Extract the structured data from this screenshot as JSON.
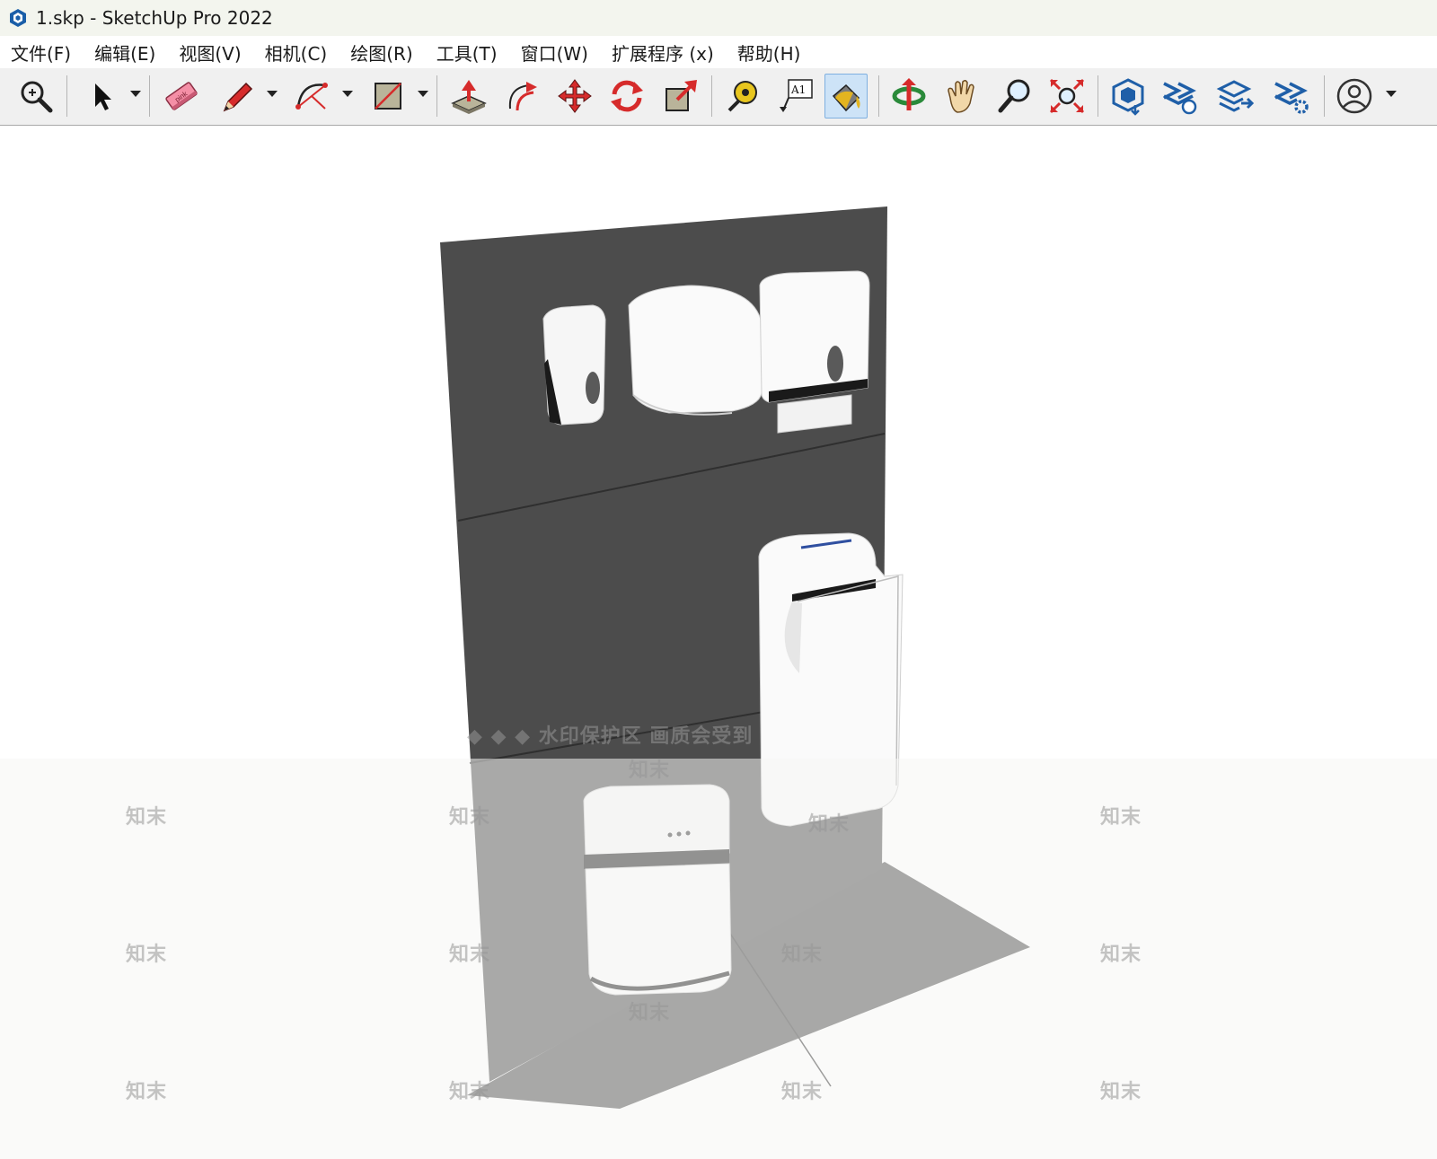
{
  "window": {
    "title": "1.skp - SketchUp Pro 2022"
  },
  "menu": [
    "文件(F)",
    "编辑(E)",
    "视图(V)",
    "相机(C)",
    "绘图(R)",
    "工具(T)",
    "窗口(W)",
    "扩展程序 (x)",
    "帮助(H)"
  ],
  "toolbar": {
    "tools": [
      {
        "name": "zoom-window-icon"
      },
      {
        "name": "select-arrow-icon"
      },
      {
        "name": "eraser-icon"
      },
      {
        "name": "pencil-line-icon"
      },
      {
        "name": "arc-icon"
      },
      {
        "name": "rectangle-icon"
      },
      {
        "name": "push-pull-icon"
      },
      {
        "name": "offset-icon"
      },
      {
        "name": "move-icon"
      },
      {
        "name": "rotate-icon"
      },
      {
        "name": "scale-icon"
      },
      {
        "name": "tape-measure-icon"
      },
      {
        "name": "text-label-icon"
      },
      {
        "name": "paint-bucket-icon"
      },
      {
        "name": "orbit-icon"
      },
      {
        "name": "pan-hand-icon"
      },
      {
        "name": "zoom-icon"
      },
      {
        "name": "zoom-extents-icon"
      },
      {
        "name": "3d-warehouse-icon"
      },
      {
        "name": "extension-warehouse-icon"
      },
      {
        "name": "layout-send-icon"
      },
      {
        "name": "extension-manager-icon"
      },
      {
        "name": "account-icon"
      }
    ],
    "text_label_glyph": "A1",
    "eraser_brand": "pink"
  },
  "viewport": {
    "watermark_banner": "◆ ◆ ◆ 水印保护区  画质会受到",
    "watermark_tile": "知末",
    "colors": {
      "wall": "#4c4c4c",
      "floor": "#4a4a4a",
      "product": "#fafafa",
      "accent": "#2f4fa0"
    }
  }
}
